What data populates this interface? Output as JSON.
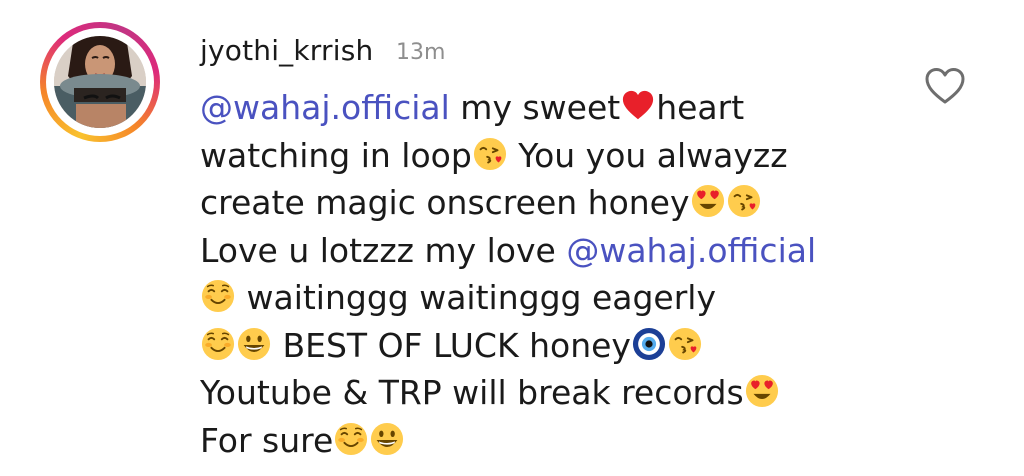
{
  "comment": {
    "username": "jyothi_krrish",
    "timestamp": "13m",
    "mention": "@wahaj.official",
    "segments": {
      "l1_text": " my sweet",
      "l1_text2": "heart",
      "l2_text": "watching in loop",
      "l2_text2": " You you alwayzz",
      "l3_text": "create magic onscreen honey",
      "l4_text": "Love u lotzzz my love ",
      "l5_text": " waitinggg waitinggg eagerly",
      "l6_text": " BEST OF LUCK honey",
      "l7_text": "Youtube & TRP will break records",
      "l8_text": "For sure"
    },
    "icons": {
      "like": "heart-outline-icon",
      "emojis": [
        "red-heart",
        "face-blowing-kiss",
        "smiling-face-heart-eyes",
        "smiling-face",
        "grinning-face",
        "nazar-amulet"
      ]
    },
    "colors": {
      "mention": "#4a52c0",
      "text": "#1a1a1a",
      "timestamp": "#8e8e8e",
      "like_outline": "#6e6e6e"
    }
  }
}
